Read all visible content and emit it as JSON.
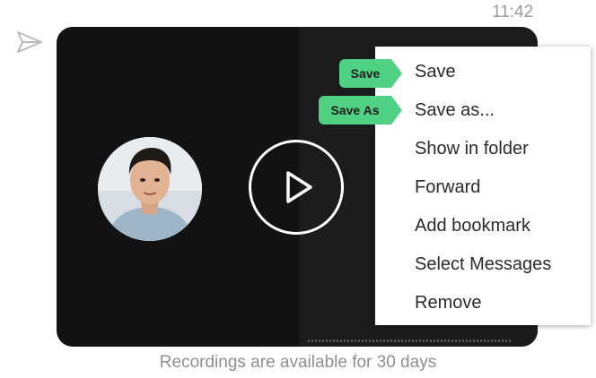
{
  "message": {
    "timestamp": "11:42",
    "status_icon": "paper-plane-icon",
    "retention_note": "Recordings are available for 30 days"
  },
  "video": {
    "play_icon": "play-icon",
    "background_color": "#121212"
  },
  "context_menu": {
    "items": [
      {
        "label": "Save"
      },
      {
        "label": "Save as..."
      },
      {
        "label": "Show in folder"
      },
      {
        "label": "Forward"
      },
      {
        "label": "Add bookmark"
      },
      {
        "label": "Select Messages"
      },
      {
        "label": "Remove"
      }
    ]
  },
  "annotations": {
    "save_tag": "Save",
    "save_as_tag": "Save As",
    "color": "#4fd283"
  }
}
